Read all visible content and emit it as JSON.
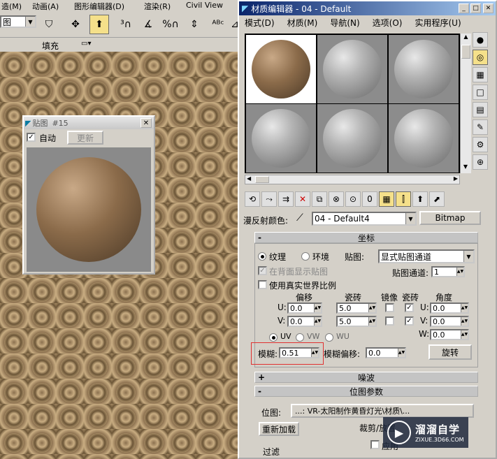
{
  "main_menu": [
    "造(M)",
    "动画(A)",
    "图形编辑器(D)",
    "渲染(R)",
    "Civil View"
  ],
  "toolbar": {
    "view_dropdown": "图",
    "fill_label": "填充"
  },
  "mini_window": {
    "title": "贴图",
    "title_id": "#15",
    "auto_label": "自动",
    "update_button": "更新",
    "close": "✕"
  },
  "material_editor": {
    "title": "材质编辑器 - 04 - Default",
    "menu": [
      "模式(D)",
      "材质(M)",
      "导航(N)",
      "选项(O)",
      "实用程序(U)"
    ],
    "diffuse_label": "漫反射颜色:",
    "material_name": "04 - Default4",
    "map_type_button": "Bitmap",
    "coords": {
      "header": "坐标",
      "texture_radio": "纹理",
      "environ_radio": "环境",
      "mapping_label": "贴图:",
      "mapping_value": "显式贴图通道",
      "show_back_label": "在背面显示贴图",
      "map_channel_label": "贴图通道:",
      "map_channel_value": "1",
      "real_world_label": "使用真实世界比例",
      "offset_label": "偏移",
      "tiling_label": "瓷砖",
      "mirror_label": "镜像",
      "tile_label": "瓷砖",
      "angle_label": "角度",
      "u_label": "U:",
      "v_label": "V:",
      "w_label": "W:",
      "u_offset": "0.0",
      "v_offset": "0.0",
      "u_tiling": "5.0",
      "v_tiling": "5.0",
      "u_angle": "0.0",
      "v_angle": "0.0",
      "w_angle": "0.0",
      "uv_label": "UV",
      "vw_label": "VW",
      "wu_label": "WU",
      "blur_label": "模糊:",
      "blur_value": "0.51",
      "blur_offset_label": "模糊偏移:",
      "blur_offset_value": "0.0",
      "rotate_button": "旋转"
    },
    "noise_header": "噪波",
    "bitmap_params_header": "位图参数",
    "bitmap_label": "位图:",
    "bitmap_path": "...: VR-太阳制作黄昏灯光\\材质\\...",
    "reload_button": "重新加载",
    "crop_label": "裁剪/放置",
    "apply_label": "应用",
    "filter_label": "过滤"
  },
  "watermark": {
    "name": "溜溜自学",
    "url": "ZIXUE.3D66.COM"
  }
}
